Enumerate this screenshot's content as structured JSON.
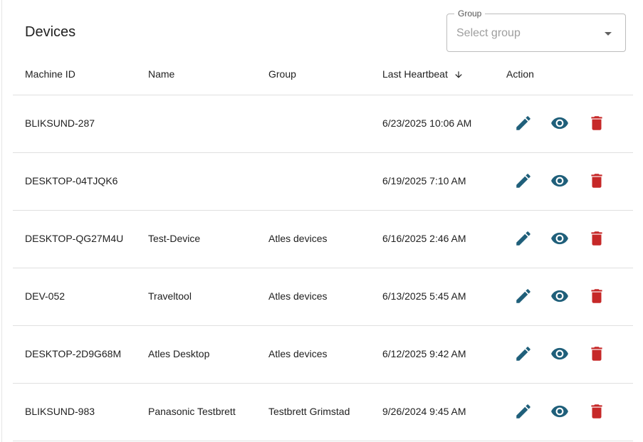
{
  "page": {
    "title": "Devices"
  },
  "filter": {
    "label": "Group",
    "placeholder": "Select group"
  },
  "table": {
    "headers": {
      "machine_id": "Machine ID",
      "name": "Name",
      "group": "Group",
      "last_heartbeat": "Last Heartbeat",
      "action": "Action"
    },
    "sort": {
      "column": "last_heartbeat",
      "direction": "descending"
    },
    "rows": [
      {
        "machine_id": "BLIKSUND-287",
        "name": "",
        "group": "",
        "last_heartbeat": "6/23/2025 10:06 AM"
      },
      {
        "machine_id": "DESKTOP-04TJQK6",
        "name": "",
        "group": "",
        "last_heartbeat": "6/19/2025 7:10 AM"
      },
      {
        "machine_id": "DESKTOP-QG27M4U",
        "name": "Test-Device",
        "group": "Atles devices",
        "last_heartbeat": "6/16/2025 2:46 AM"
      },
      {
        "machine_id": "DEV-052",
        "name": "Traveltool",
        "group": "Atles devices",
        "last_heartbeat": "6/13/2025 5:45 AM"
      },
      {
        "machine_id": "DESKTOP-2D9G68M",
        "name": "Atles Desktop",
        "group": "Atles devices",
        "last_heartbeat": "6/12/2025 9:42 AM"
      },
      {
        "machine_id": "BLIKSUND-983",
        "name": "Panasonic Testbrett",
        "group": "Testbrett Grimstad",
        "last_heartbeat": "9/26/2024 9:45 AM"
      }
    ]
  },
  "icons": {
    "edit": "pencil-icon",
    "view": "eye-icon",
    "delete": "trash-icon",
    "sort": "arrow-down-icon",
    "dropdown": "caret-down-icon"
  },
  "colors": {
    "action_primary": "#1f5f7a",
    "action_delete": "#c62828"
  }
}
